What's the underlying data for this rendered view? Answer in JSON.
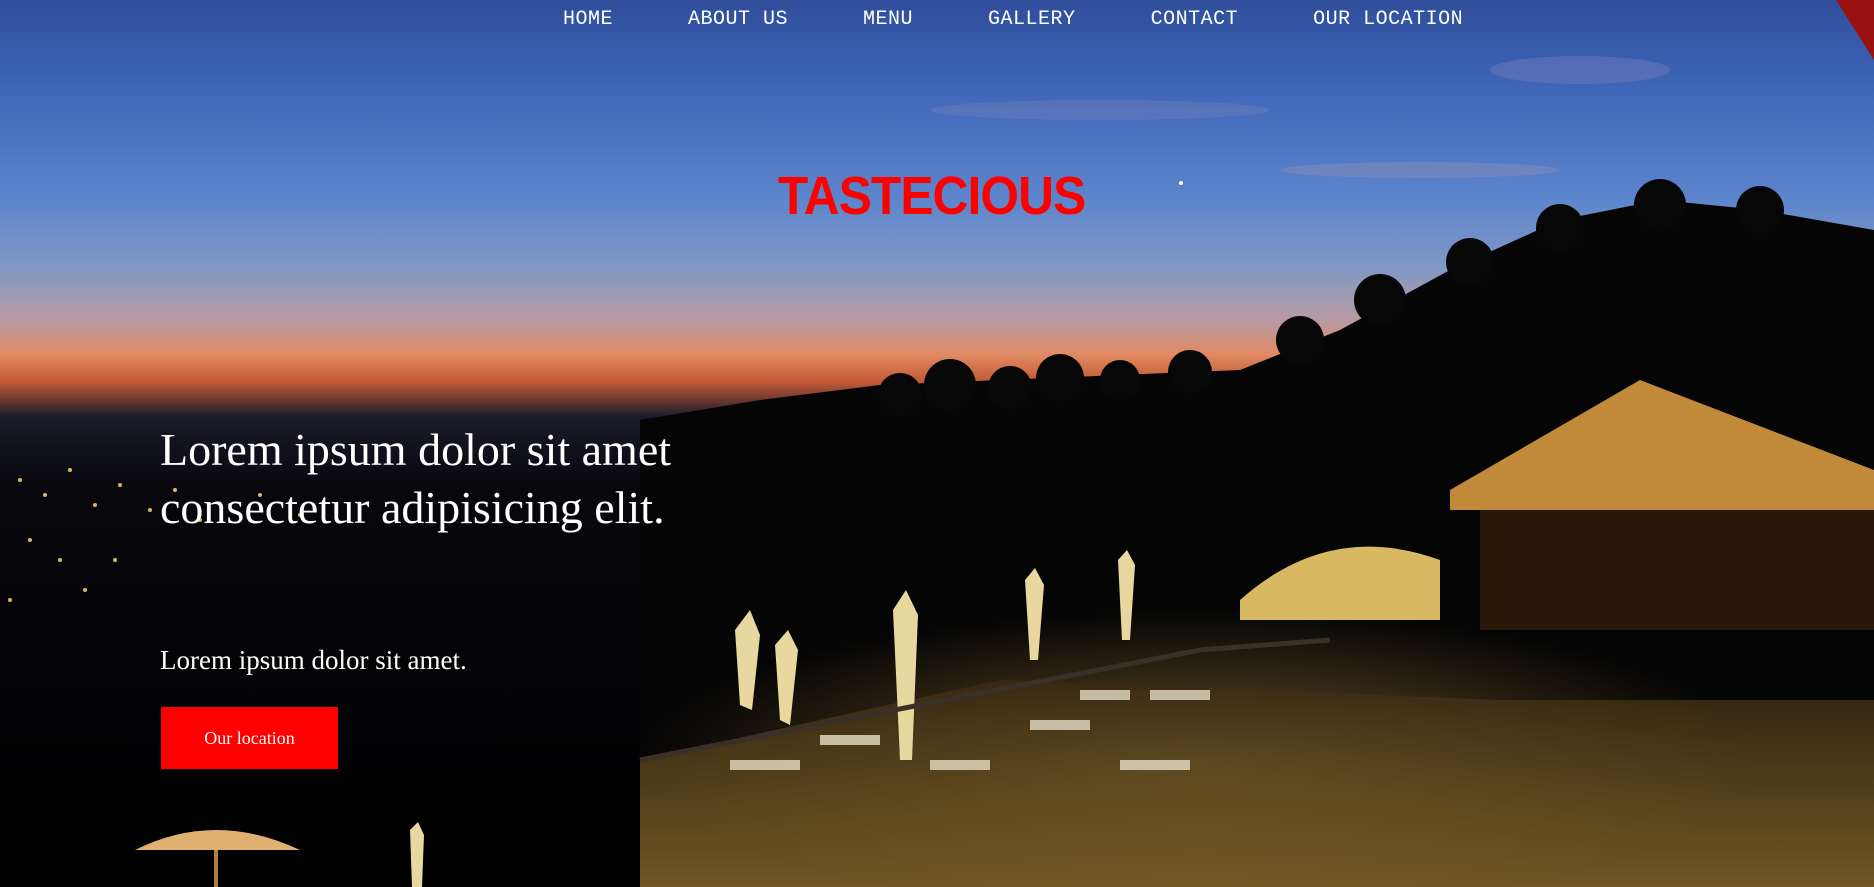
{
  "nav": {
    "items": [
      {
        "label": "HOME"
      },
      {
        "label": "ABOUT US"
      },
      {
        "label": "MENU"
      },
      {
        "label": "GALLERY"
      },
      {
        "label": "CONTACT"
      },
      {
        "label": "OUR LOCATION"
      }
    ]
  },
  "brand": {
    "title": "TASTECIOUS",
    "color": "#ff0000"
  },
  "hero": {
    "headline": "Lorem ipsum dolor sit amet consectetur adipisicing elit.",
    "subline": "Lorem ipsum dolor sit amet.",
    "button_label": "Our location",
    "button_color": "#ff0000"
  }
}
